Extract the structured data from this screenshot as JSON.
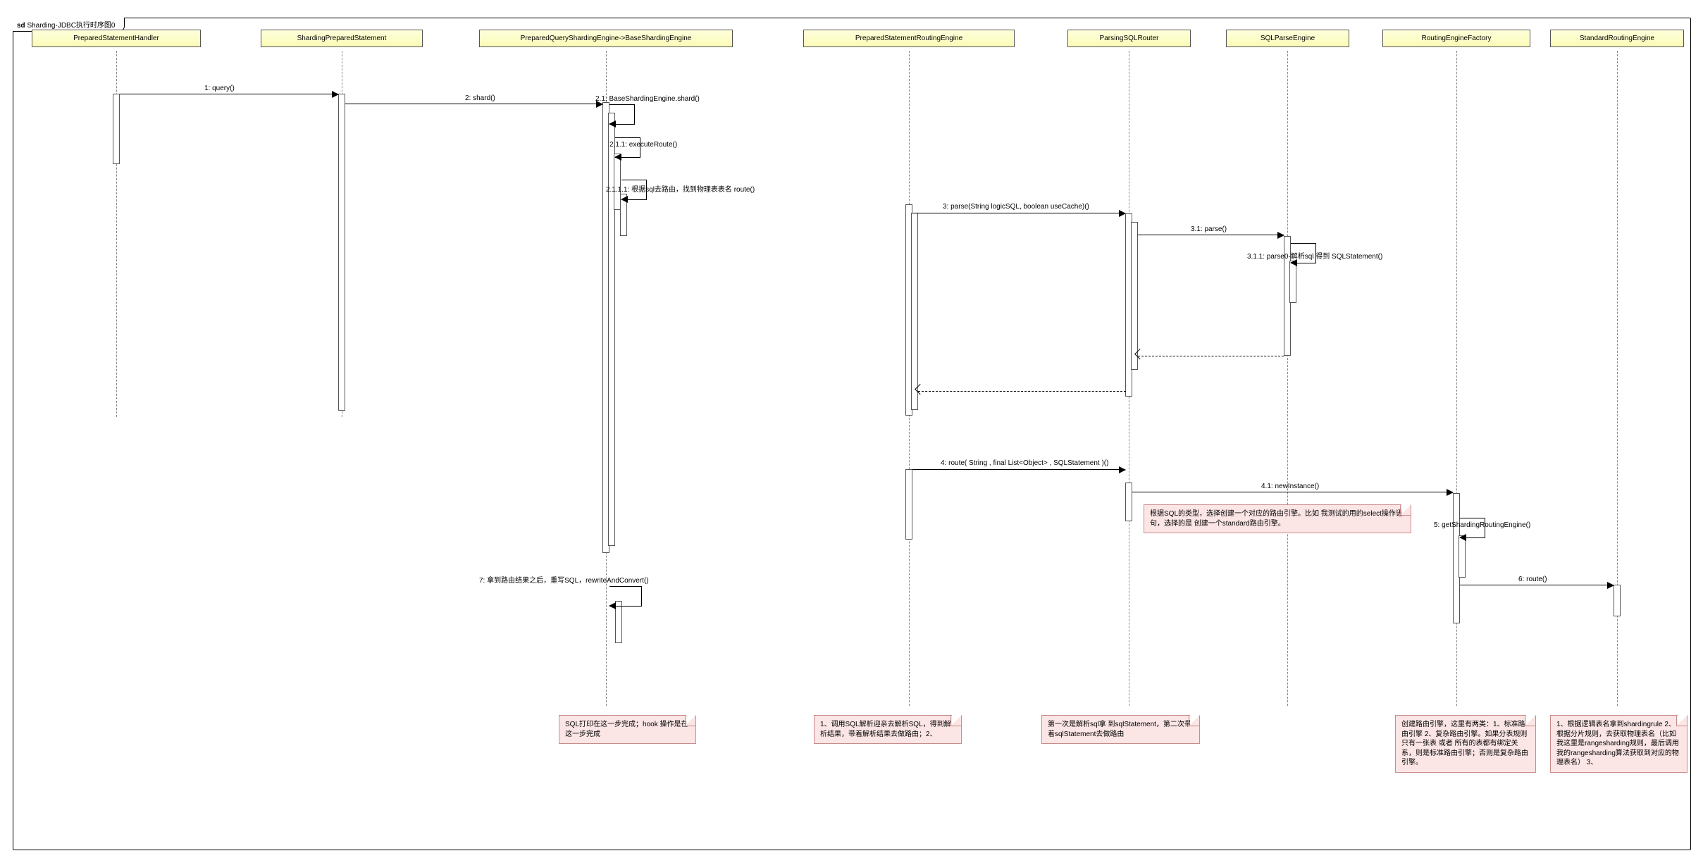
{
  "frame_title_prefix": "sd",
  "frame_title": "Sharding-JDBC执行时序图0",
  "lifelines": {
    "l1": "PreparedStatementHandler",
    "l2": "ShardingPreparedStatement",
    "l3": "PreparedQueryShardingEngine->BaseShardingEngine",
    "l4": "PreparedStatementRoutingEngine",
    "l5": "ParsingSQLRouter",
    "l6": "SQLParseEngine",
    "l7": "RoutingEngineFactory",
    "l8": "StandardRoutingEngine"
  },
  "messages": {
    "m1": "1: query()",
    "m2": "2: shard()",
    "m21": "2.1: BaseShardingEngine.shard()",
    "m211": "2.1.1: executeRoute()",
    "m2111": "2.1.1.1: 根据sql去路由，找到物理表表名 route()",
    "m3": "3: parse(String logicSQL, boolean useCache)()",
    "m31": "3.1: parse()",
    "m311": "3.1.1: parse0-解析sql 得到 SQLStatement()",
    "m4": "4: route( String , final List<Object> ,  SQLStatement )()",
    "m41": "4.1: newInstance()",
    "m5": "5: getShardingRoutingEngine()",
    "m6": "6: route()",
    "m7": "7: 拿到路由结果之后，重写SQL，rewriteAndConvert()"
  },
  "notes": {
    "n1": "根据SQL的类型，选择创建一个对应的路由引擎。比如 我测试的用的select操作语句，选择的是 创建一个standard路由引擎。",
    "n2": "SQL打印在这一步完成；hook 操作是在这一步完成",
    "n3": "1、调用SQL解析迎亲去解析SQL，得到解析结果，带着解析结果去做路由；2、",
    "n4": "第一次是解析sql拿 到sqlStatement，第二次带着sqlStatement去做路由",
    "n5": "创建路由引擎，这里有两类：1、标准路由引擎 2、复杂路由引擎。如果分表规则只有一张表 或者 所有的表都有绑定关系，则是标准路由引擎；否则是复杂路由引擎。",
    "n6": "1、根据逻辑表名拿到shardingrule 2、根据分片规则，去获取物理表名（比如我这里是rangesharding规则，最后调用我的rangesharding算法获取到对应的物理表名） 3、"
  }
}
